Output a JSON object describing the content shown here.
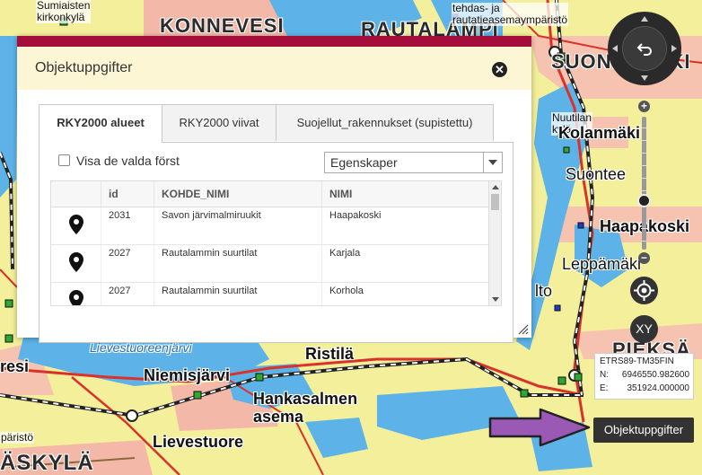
{
  "map": {
    "labels": {
      "sumiaisten": "Sumiaisten\nkirkonkylä",
      "konnevesi": "KONNEVESI",
      "rautalampi": "RAUTALAMPI",
      "tehdas": "tehdas- ja\nrautatieasemaympäristö",
      "suonenjoki": "SUONENJOKI",
      "nuutilan": "Nuutilan\nkylä",
      "kolanmaki": "Kolanmäki",
      "suontee": "Suontee",
      "haapakoski": "Haapakoski",
      "leppamaki": "Leppämäki",
      "lto": "lto",
      "resi": "resi",
      "lievestuoreenjarvi": "Lievestuoreenjärvi",
      "ristila": "Ristilä",
      "niemisjarvi": "Niemisjärvi",
      "hankasalmen": "Hankasalmen\nasema",
      "lievestuore": "Lievestuore",
      "paristo": "päristö",
      "askyla": "ÄSKYLÄ",
      "pieksa": "PIEKSÄ"
    }
  },
  "popup": {
    "title": "Objektuppgifter",
    "close_icon": "close-icon",
    "tabs": [
      {
        "label": "RKY2000 alueet",
        "active": true
      },
      {
        "label": "RKY2000 viivat",
        "active": false
      },
      {
        "label": "Suojellut_rakennukset (supistettu)",
        "active": false
      }
    ],
    "visa_label": "Visa de valda först",
    "visa_checked": false,
    "select_value": "Egenskaper",
    "table": {
      "columns": [
        "",
        "id",
        "KOHDE_NIMI",
        "NIMI"
      ],
      "rows": [
        {
          "id": "2031",
          "kohde": "Savon järvimalmiruukit",
          "nimi": "Haapakoski"
        },
        {
          "id": "2027",
          "kohde": "Rautalammin suurtilat",
          "nimi": "Karjala"
        },
        {
          "id": "2027",
          "kohde": "Rautalammin suurtilat",
          "nimi": "Korhola"
        }
      ]
    }
  },
  "controls": {
    "xy_label": "XY",
    "zoom_in": "+",
    "zoom_out": "−"
  },
  "coordinates": {
    "crs": "ETRS89-TM35FIN",
    "n_label": "N:",
    "n_value": "6946550.982600",
    "e_label": "E:",
    "e_value": "351924.000000"
  },
  "object_button": "Objektuppgifter",
  "colors": {
    "popup_topbar": "#a50e3a",
    "popup_header": "#fdf6d4",
    "arrow": "#9b59b6",
    "control": "#333333"
  }
}
